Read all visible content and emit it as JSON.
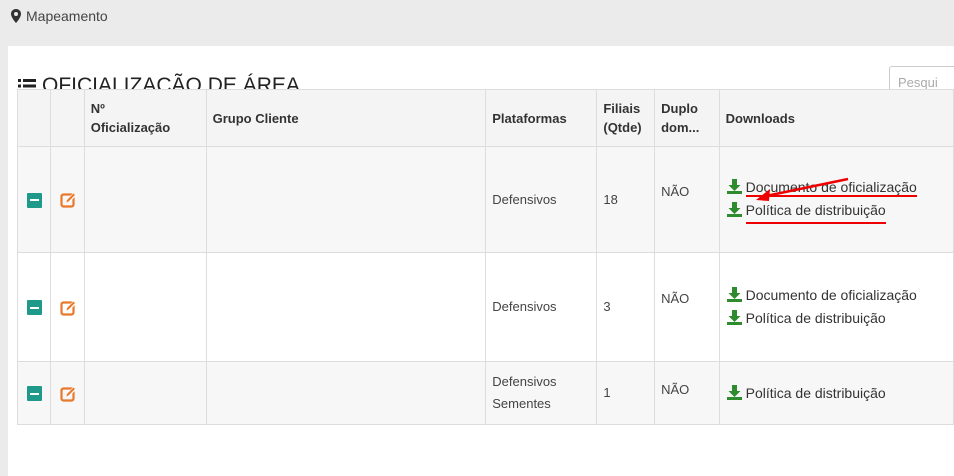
{
  "breadcrumb": {
    "label": "Mapeamento"
  },
  "page": {
    "title": "OFICIALIZAÇÃO DE ÁREA"
  },
  "search": {
    "placeholder": "Pesqui"
  },
  "table": {
    "headers": {
      "numero": "Nº\nOficialização",
      "grupo": "Grupo Cliente",
      "plataformas": "Plataformas",
      "filiais": "Filiais\n(Qtde)",
      "duplo": "Duplo\ndom...",
      "downloads": "Downloads"
    },
    "rows": [
      {
        "plataformas": "Defensivos",
        "filiais": "18",
        "duplo": "NÃO",
        "downloads": [
          "Documento de oficialização",
          "Política de distribuição"
        ]
      },
      {
        "plataformas": "Defensivos",
        "filiais": "3",
        "duplo": "NÃO",
        "downloads": [
          "Documento de oficialização",
          "Política de distribuição"
        ]
      },
      {
        "plataformas": "Defensivos Sementes",
        "filiais": "1",
        "duplo": "NÃO",
        "downloads": [
          "Política de distribuição"
        ]
      }
    ]
  },
  "colors": {
    "accent_teal": "#1f9a8a",
    "edit_orange": "#e8792b",
    "download_green": "#2e8b2e",
    "annotation_red": "#e00000"
  }
}
